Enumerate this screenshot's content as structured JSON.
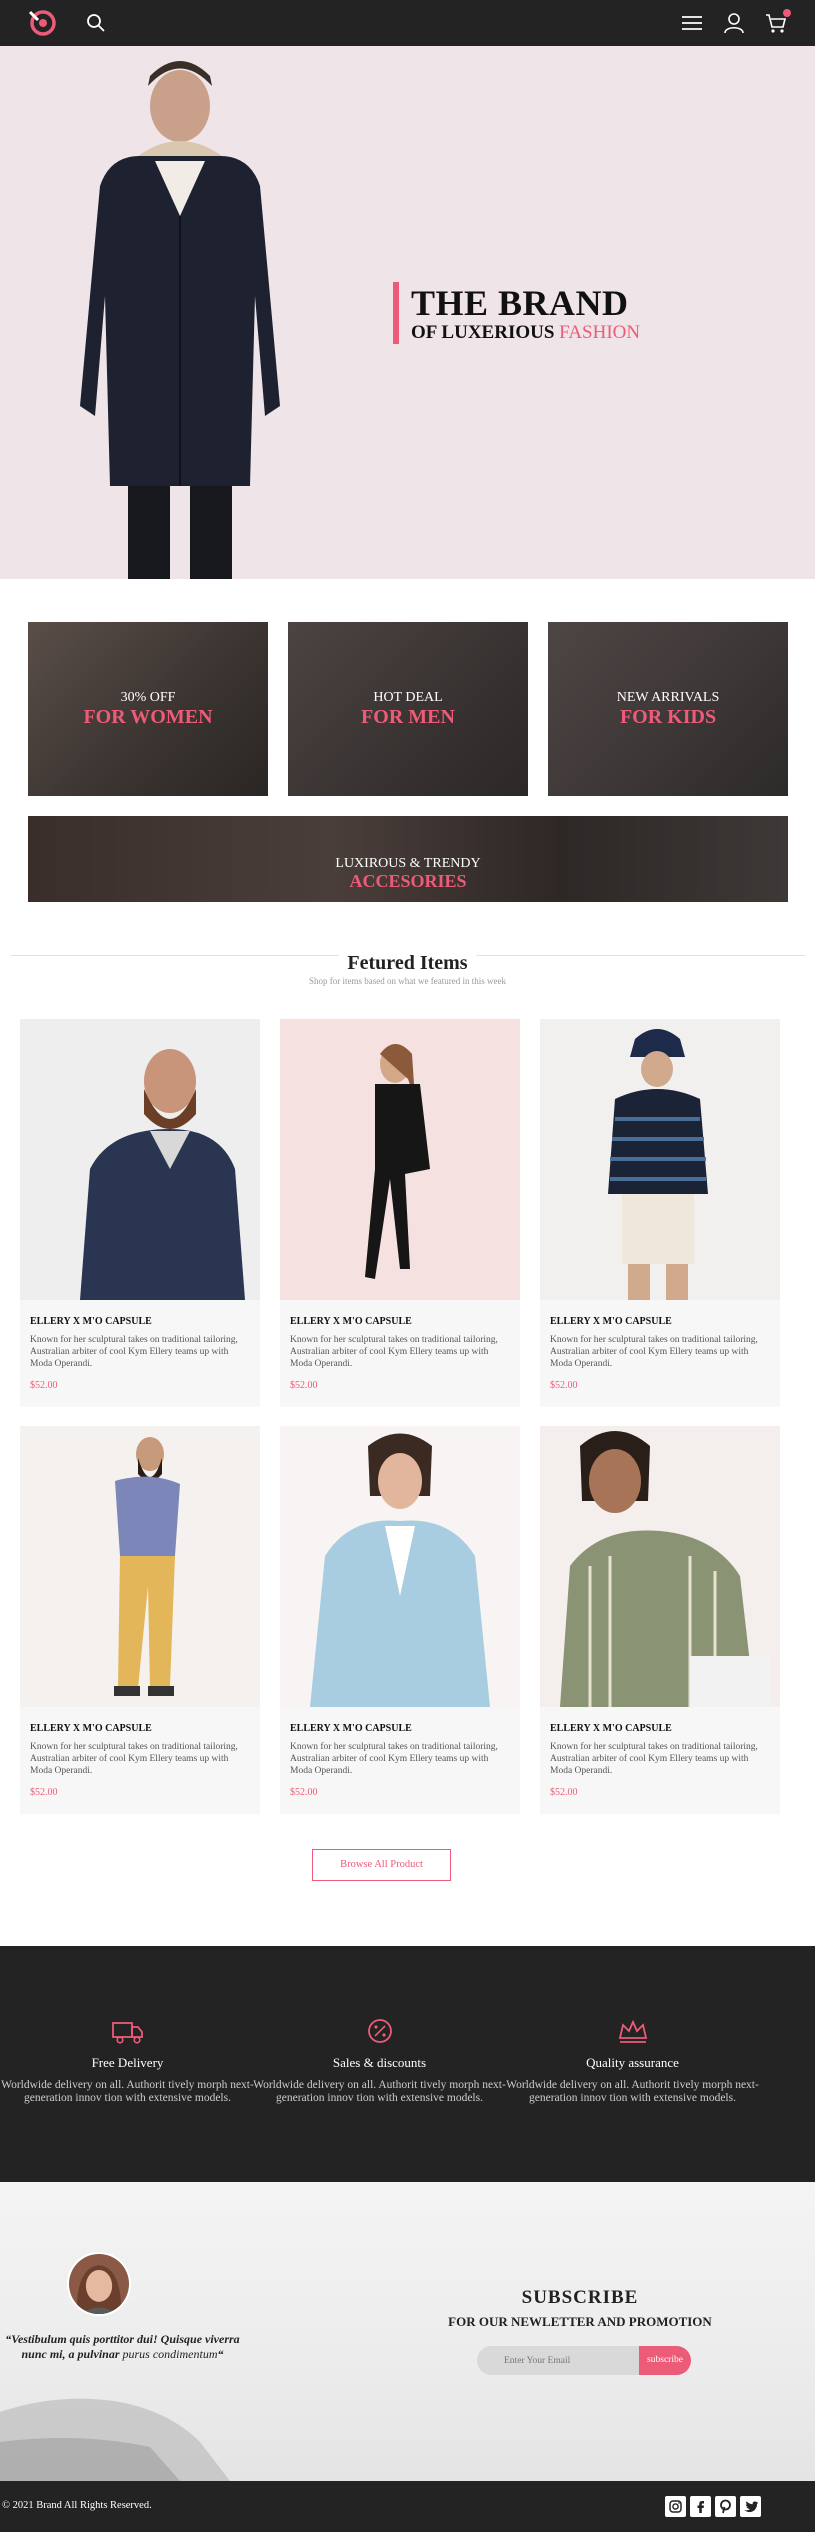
{
  "colors": {
    "accent": "#ec5b77",
    "dark": "#232323",
    "hero_bg": "#efe4e7"
  },
  "header": {
    "icons": [
      "logo-icon",
      "search-icon",
      "menu-icon",
      "user-icon",
      "cart-icon"
    ]
  },
  "hero": {
    "title": "THE BRAND",
    "subtitle_prefix": "OF LUXERIOUS",
    "subtitle_accent": "FASHION"
  },
  "categories": [
    {
      "line1": "30% OFF",
      "line2": "FOR WOMEN"
    },
    {
      "line1": "HOT DEAL",
      "line2": "FOR MEN"
    },
    {
      "line1": "NEW ARRIVALS",
      "line2": "FOR KIDS"
    },
    {
      "line1": "LUXIROUS & TRENDY",
      "line2": "ACCESORIES"
    }
  ],
  "featured": {
    "title": "Fetured Items",
    "subtitle": "Shop for items based on what we featured in this week",
    "products": [
      {
        "name": "ELLERY X M'O CAPSULE",
        "desc": "Known for her sculptural takes on traditional tailoring, Australian arbiter of cool Kym Ellery teams up with Moda Operandi.",
        "price": "$52.00"
      },
      {
        "name": "ELLERY X M'O CAPSULE",
        "desc": "Known for her sculptural takes on traditional tailoring, Australian arbiter of cool Kym Ellery teams up with Moda Operandi.",
        "price": "$52.00"
      },
      {
        "name": "ELLERY X M'O CAPSULE",
        "desc": "Known for her sculptural takes on traditional tailoring, Australian arbiter of cool Kym Ellery teams up with Moda Operandi.",
        "price": "$52.00"
      },
      {
        "name": "ELLERY X M'O CAPSULE",
        "desc": "Known for her sculptural takes on traditional tailoring, Australian arbiter of cool Kym Ellery teams up with Moda Operandi.",
        "price": "$52.00"
      },
      {
        "name": "ELLERY X M'O CAPSULE",
        "desc": "Known for her sculptural takes on traditional tailoring, Australian arbiter of cool Kym Ellery teams up with Moda Operandi.",
        "price": "$52.00"
      },
      {
        "name": "ELLERY X M'O CAPSULE",
        "desc": "Known for her sculptural takes on traditional tailoring, Australian arbiter of cool Kym Ellery teams up with Moda Operandi.",
        "price": "$52.00"
      }
    ],
    "browse_label": "Browse All Product"
  },
  "features": [
    {
      "icon": "truck-icon",
      "title": "Free Delivery",
      "desc": "Worldwide delivery on all. Authorit tively morph next-generation innov tion with extensive models."
    },
    {
      "icon": "percent-badge-icon",
      "title": "Sales & discounts",
      "desc": "Worldwide delivery on all. Authorit tively morph next-generation innov tion with extensive models."
    },
    {
      "icon": "crown-icon",
      "title": "Quality assurance",
      "desc": "Worldwide delivery on all. Authorit tively morph next-generation innov tion with extensive models."
    }
  ],
  "testimonial": {
    "quote_main": "“Vestibulum quis porttitor dui! Quisque viverra nunc mi, a pulvinar",
    "quote_italic": "purus condimentum",
    "quote_end": "“"
  },
  "newsletter": {
    "title": "SUBSCRIBE",
    "subtitle": "FOR OUR NEWLETTER AND PROMOTION",
    "email_placeholder": "Enter Your Email",
    "button_label": "subscribe"
  },
  "footer": {
    "copyright": "© 2021 Brand All Rights Reserved.",
    "social": [
      "instagram-icon",
      "facebook-icon",
      "pinterest-icon",
      "twitter-icon"
    ]
  }
}
